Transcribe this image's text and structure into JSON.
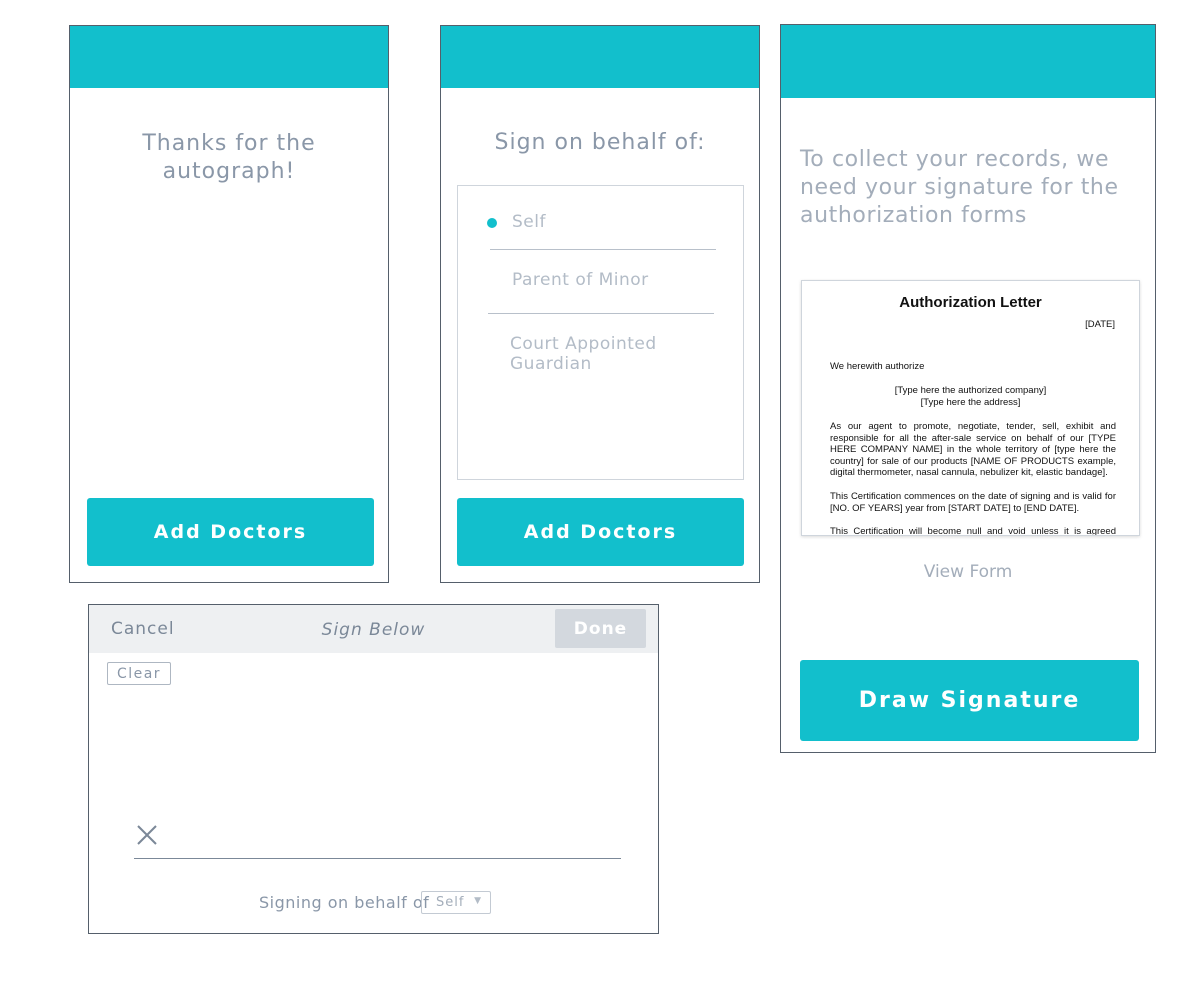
{
  "colors": {
    "accent": "#12bfcc",
    "text_muted": "#8a97a8",
    "text_light": "#a3adba",
    "done_disabled": "#d3d8de"
  },
  "screen_thanks": {
    "message": "Thanks for the autograph!",
    "button_label": "Add Doctors"
  },
  "screen_behalf": {
    "title": "Sign on behalf of:",
    "options": [
      {
        "label": "Self",
        "selected": true
      },
      {
        "label": "Parent of Minor",
        "selected": false
      },
      {
        "label": "Court Appointed Guardian",
        "selected": false
      }
    ],
    "button_label": "Add Doctors"
  },
  "screen_records": {
    "intro": "To collect your records, we need your signature for the authorization forms",
    "document": {
      "title": "Authorization Letter",
      "date": "[DATE]",
      "line1": "We herewith authorize",
      "line2": "[Type here the authorized company]",
      "line3": "[Type here the address]",
      "para1": "As our agent to promote, negotiate, tender, sell, exhibit and responsible for all the after-sale service on behalf of our [TYPE HERE COMPANY NAME] in the whole territory of [type here the country] for sale of our products [NAME OF PRODUCTS example, digital thermometer, nasal cannula, nebulizer kit, elastic bandage].",
      "para2": "This Certification commences on the date of signing and is valid for [NO. OF YEARS] year from [START DATE] to [END DATE].",
      "para3": "This Certification will become null and void unless it is agreed between"
    },
    "view_form_label": "View Form",
    "button_label": "Draw Signature"
  },
  "screen_sign": {
    "cancel_label": "Cancel",
    "title": "Sign Below",
    "done_label": "Done",
    "clear_label": "Clear",
    "behalf_label": "Signing on behalf of",
    "behalf_value": "Self",
    "caret": "▼"
  }
}
